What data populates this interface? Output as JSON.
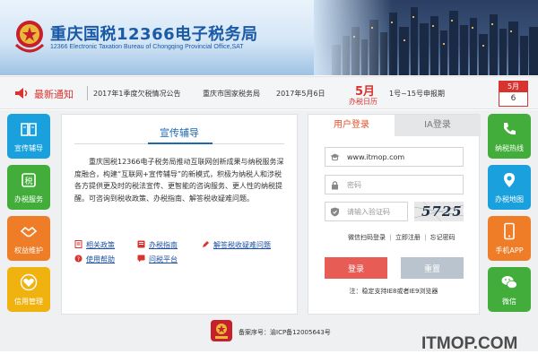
{
  "header": {
    "title": "重庆国税12366电子税务局",
    "subtitle": "12366 Electronic Taxation Bureau of Chongqing Provincial Office,SAT"
  },
  "notice": {
    "label": "最新通知",
    "item_title": "2017年1季度欠税情况公告",
    "item_org": "重庆市国家税务局",
    "item_date": "2017年5月6日",
    "calendar_month": "5月",
    "calendar_label": "办税日历",
    "calendar_range": "1号~15号申报期",
    "date_badge_month": "5月",
    "date_badge_day": "6"
  },
  "left_tiles": [
    {
      "label": "宣传辅导",
      "icon": "book-icon",
      "color": "#1aa0dd"
    },
    {
      "label": "办税服务",
      "icon": "tax-service-icon",
      "color": "#43ad3b"
    },
    {
      "label": "权益维护",
      "icon": "handshake-icon",
      "color": "#ef7d27"
    },
    {
      "label": "信用管理",
      "icon": "heart-icon",
      "color": "#f0b20e"
    }
  ],
  "right_tiles": [
    {
      "label": "纳税热线",
      "icon": "phone-icon",
      "color": "#43ad3b"
    },
    {
      "label": "办税地图",
      "icon": "map-pin-icon",
      "color": "#1aa0dd"
    },
    {
      "label": "手机APP",
      "icon": "mobile-icon",
      "color": "#ef7d27"
    },
    {
      "label": "微信",
      "icon": "wechat-icon",
      "color": "#43ad3b"
    }
  ],
  "panel": {
    "title": "宣传辅导",
    "body": "重庆国税12366电子税务局推动互联网创新成果与纳税服务深度融合，构建“互联网+宣传辅导”的新模式，积极为纳税人和涉税各方提供更及时的税法宣传、更智能的咨询服务、更人性的纳税提醒。可咨询到税收政策、办税指南、解答税收疑难问题。",
    "links": [
      "相关政策",
      "办税指南",
      "解答税收疑难问题",
      "使用帮助",
      "问税平台"
    ]
  },
  "login": {
    "tab_user": "用户登录",
    "tab_ia": "IA登录",
    "username_value": "www.itmop.com",
    "password_placeholder": "密码",
    "captcha_placeholder": "请输入验证码",
    "captcha_text": "5725",
    "links": [
      "微信扫码登录",
      "立即注册",
      "忘记密码"
    ],
    "separator": "|",
    "login_button": "登录",
    "reset_button": "重置",
    "note": "注：稳定支持IE8或者IE9浏览器"
  },
  "footer": {
    "icp": "备案序号：渝ICP备12005643号",
    "watermark": "ITMOP.COM"
  }
}
